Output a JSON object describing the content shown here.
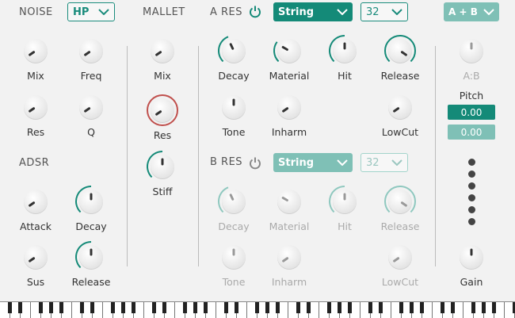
{
  "noise": {
    "label": "NOISE",
    "filter_type": "HP"
  },
  "mallet": {
    "label": "MALLET"
  },
  "a_res": {
    "label": "A RES",
    "type": "String",
    "voices": "32"
  },
  "b_res": {
    "label": "B RES",
    "type": "String",
    "voices": "32"
  },
  "mode": {
    "value": "A + B"
  },
  "adsr": {
    "label": "ADSR"
  },
  "knobs": {
    "mix": "Mix",
    "freq": "Freq",
    "res": "Res",
    "q": "Q",
    "attack": "Attack",
    "decay": "Decay",
    "sus": "Sus",
    "release": "Release",
    "mallet_mix": "Mix",
    "mallet_res": "Res",
    "stiff": "Stiff",
    "a_decay": "Decay",
    "a_material": "Material",
    "a_hit": "Hit",
    "a_release": "Release",
    "a_tone": "Tone",
    "a_inharm": "Inharm",
    "a_lowcut": "LowCut",
    "b_decay": "Decay",
    "b_material": "Material",
    "b_hit": "Hit",
    "b_release": "Release",
    "b_tone": "Tone",
    "b_inharm": "Inharm",
    "b_lowcut": "LowCut",
    "ab": "A:B",
    "gain": "Gain"
  },
  "pitch": {
    "label": "Pitch",
    "value1": "0.00",
    "value2": "0.00"
  },
  "colors": {
    "accent": "#148a78",
    "accent_light": "#7fc0b6",
    "mallet_res_ring": "#c0504d"
  }
}
